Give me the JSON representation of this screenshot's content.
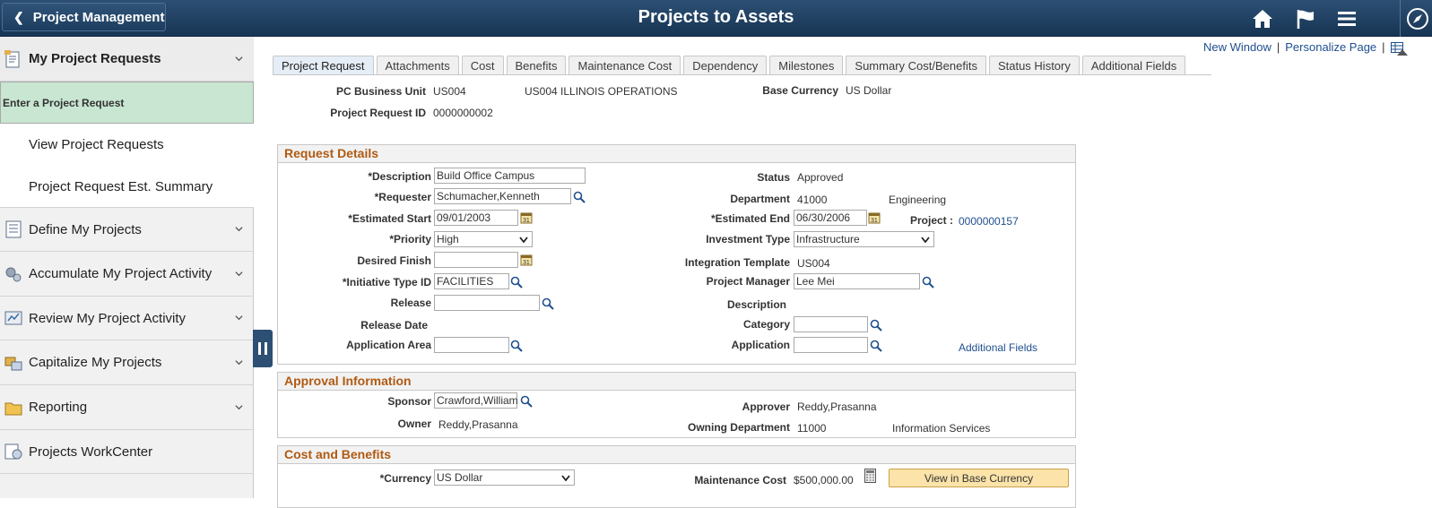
{
  "header": {
    "back_label": "Project Management",
    "title": "Projects to Assets",
    "icons": [
      "home-icon",
      "flag-icon",
      "menu-icon",
      "compass-icon"
    ]
  },
  "sidebar": {
    "sections": [
      {
        "label": "My Project Requests",
        "icon": "request-icon",
        "expanded": true
      },
      {
        "label": "Define My Projects",
        "icon": "list-icon"
      },
      {
        "label": "Accumulate My Project Activity",
        "icon": "gears-icon"
      },
      {
        "label": "Review My Project Activity",
        "icon": "review-icon"
      },
      {
        "label": "Capitalize My Projects",
        "icon": "capitalize-icon"
      },
      {
        "label": "Reporting",
        "icon": "folder-icon"
      },
      {
        "label": "Projects WorkCenter",
        "icon": "workcenter-icon"
      }
    ],
    "sub_items": [
      "Enter a Project Request",
      "View Project Requests",
      "Project Request Est. Summary"
    ]
  },
  "toplinks": {
    "new_window": "New Window",
    "personalize": "Personalize Page"
  },
  "tabs": [
    "Project Request",
    "Attachments",
    "Cost",
    "Benefits",
    "Maintenance Cost",
    "Dependency",
    "Milestones",
    "Summary Cost/Benefits",
    "Status History",
    "Additional Fields"
  ],
  "top_fields": {
    "bu_label": "PC Business Unit",
    "bu_value": "US004",
    "bu_desc": "US004 ILLINOIS OPERATIONS",
    "currency_label": "Base Currency",
    "currency_value": "US Dollar",
    "req_id_label": "Project Request ID",
    "req_id_value": "0000000002"
  },
  "request_details": {
    "title": "Request Details",
    "description_label": "*Description",
    "description_value": "Build Office Campus",
    "requester_label": "*Requester",
    "requester_value": "Schumacher,Kenneth",
    "est_start_label": "*Estimated Start",
    "est_start_value": "09/01/2003",
    "priority_label": "*Priority",
    "priority_value": "High",
    "desired_finish_label": "Desired Finish",
    "desired_finish_value": "",
    "initiative_label": "*Initiative Type ID",
    "initiative_value": "FACILITIES",
    "release_label": "Release",
    "release_value": "",
    "release_date_label": "Release Date",
    "app_area_label": "Application Area",
    "app_area_value": "",
    "status_label": "Status",
    "status_value": "Approved",
    "department_label": "Department",
    "department_value": "41000",
    "department_desc": "Engineering",
    "est_end_label": "*Estimated End",
    "est_end_value": "06/30/2006",
    "project_label": "Project :",
    "project_value": "0000000157",
    "investment_label": "Investment Type",
    "investment_value": "Infrastructure",
    "integration_label": "Integration Template",
    "integration_value": "US004",
    "pm_label": "Project Manager",
    "pm_value": "Lee Mei",
    "description2_label": "Description",
    "category_label": "Category",
    "category_value": "",
    "application_label": "Application",
    "application_value": "",
    "additional_fields_link": "Additional Fields"
  },
  "approval": {
    "title": "Approval Information",
    "sponsor_label": "Sponsor",
    "sponsor_value": "Crawford,William",
    "owner_label": "Owner",
    "owner_value": "Reddy,Prasanna",
    "approver_label": "Approver",
    "approver_value": "Reddy,Prasanna",
    "owning_dept_label": "Owning Department",
    "owning_dept_value": "11000",
    "owning_dept_desc": "Information Services"
  },
  "cost_benefits": {
    "title": "Cost and Benefits",
    "currency_label": "*Currency",
    "currency_value": "US Dollar",
    "maint_label": "Maintenance Cost",
    "maint_value": "$500,000.00",
    "view_base_button": "View in Base Currency"
  }
}
